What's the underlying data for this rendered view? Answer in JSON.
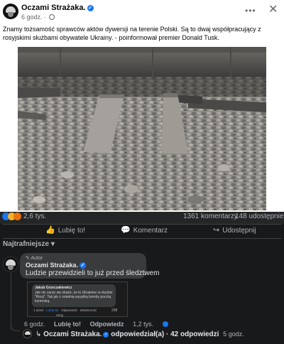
{
  "post": {
    "author": "Oczami Strażaka.",
    "time": "6 godz. ·",
    "text": "Znamy tożsamość sprawców aktów dywersji na terenie Polski. Są to dwaj współpracujący z rosyjskimi służbami obywatele Ukrainy.  - poinformował premier Donald Tusk.",
    "icons": {
      "more": "more-dots-icon",
      "close": "close-icon",
      "audience": "globe-icon"
    },
    "image": {
      "description_icon": "railway-track-photo"
    }
  },
  "stats": {
    "reactions": "2,6 tys.",
    "comments": "1361 komentarzy",
    "shares": "148 udostępnień"
  },
  "actions": {
    "like": "Lubię to!",
    "comment": "Komentarz",
    "share": "Udostępnij"
  },
  "comments_section": {
    "sort_label": "Najtrafniejsze",
    "top_comment": {
      "author_tag": "Autor",
      "author": "Oczami Strażaka.",
      "text": "Ludzie przewidzieli to już przed śledztwem",
      "screenshot": {
        "name": "Jakub Grzeczakiewicz",
        "text": "Jak nic zaraz się okaże, że to Ukrainiec w służbie \"Rosji\". Tak jak z ostatnią wysyłką bomby pocztą kurierską.",
        "time": "1 dzień",
        "like": "Lubię to!",
        "reply": "Odpowiedz",
        "message": "Wiadomość",
        "extra": "Ukryj",
        "reaction_count": "208"
      },
      "time": "6 godz.",
      "like": "Lubię to!",
      "reply": "Odpowiedz",
      "reaction_count": "1,2 tys."
    },
    "replies": {
      "author": "Oczami Strażaka.",
      "text": "odpowiedział(a) · 42 odpowiedzi",
      "time": "5 godz."
    }
  },
  "colors": {
    "background": "#18191a",
    "bubble": "#3a3b3c",
    "accent": "#1877f2",
    "text_secondary": "#b0b3b8"
  }
}
